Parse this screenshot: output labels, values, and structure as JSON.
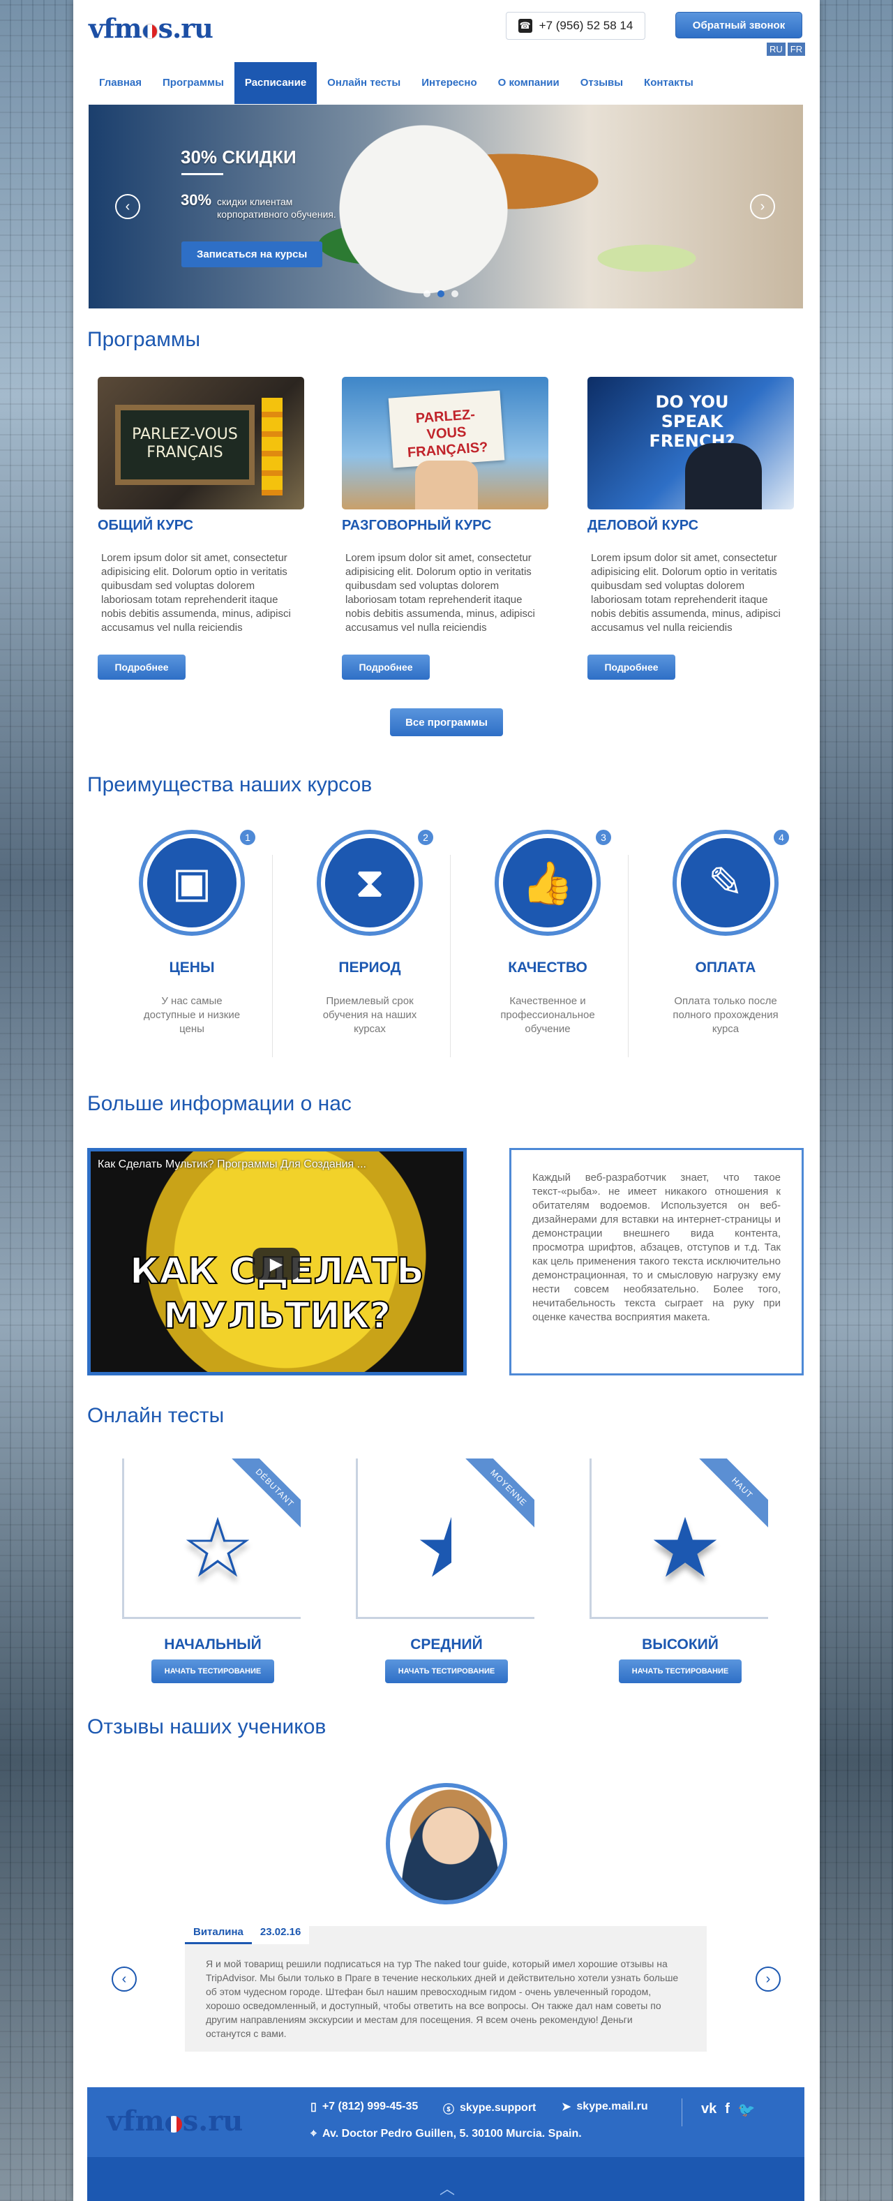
{
  "header": {
    "logo": "vfm s.ru",
    "logo_a": "vfm",
    "logo_b": "s.ru",
    "phone": "+7 (956) 52 58 14",
    "callback": "Обратный звонок",
    "langs": [
      "RU",
      "FR"
    ]
  },
  "nav": [
    "Главная",
    "Программы",
    "Расписание",
    "Онлайн тесты",
    "Интересно",
    "О компании",
    "Отзывы",
    "Контакты"
  ],
  "nav_active": "Расписание",
  "slider": {
    "title": "30% СКИДКИ",
    "big": "30%",
    "sub": "скидки клиентам корпоративного обучения.",
    "button": "Записаться на курсы"
  },
  "programs": {
    "heading": "Программы",
    "cards": [
      {
        "title": "ОБЩИЙ КУРС",
        "img_text": "PARLEZ-VOUS FRANÇAIS",
        "desc": "Lorem ipsum dolor sit amet, consectetur adipisicing elit. Dolorum optio in veritatis quibusdam sed voluptas dolorem laboriosam totam reprehenderit itaque nobis debitis assumenda, minus, adipisci accusamus vel nulla reiciendis",
        "button": "Подробнее"
      },
      {
        "title": "РАЗГОВОРНЫЙ КУРС",
        "img_text": "PARLEZ-VOUS FRANÇAIS?",
        "desc": "Lorem ipsum dolor sit amet, consectetur adipisicing elit. Dolorum optio in veritatis quibusdam sed voluptas dolorem laboriosam totam reprehenderit itaque nobis debitis assumenda, minus, adipisci accusamus vel nulla reiciendis",
        "button": "Подробнее"
      },
      {
        "title": "ДЕЛОВОЙ КУРС",
        "img_text": "DO YOU SPEAK FRENCH?",
        "desc": "Lorem ipsum dolor sit amet, consectetur adipisicing elit. Dolorum optio in veritatis quibusdam sed voluptas dolorem laboriosam totam reprehenderit itaque nobis debitis assumenda, minus, adipisci accusamus vel nulla reiciendis",
        "button": "Подробнее"
      }
    ],
    "all_button": "Все программы"
  },
  "advantages": {
    "heading": "Преимущества наших курсов",
    "items": [
      {
        "num": "1",
        "title": "ЦЕНЫ",
        "desc": "У нас самые доступные и низкие цены",
        "icon": "wallet-icon"
      },
      {
        "num": "2",
        "title": "ПЕРИОД",
        "desc": "Приемлевый срок обучения на наших курсах",
        "icon": "hourglass-icon"
      },
      {
        "num": "3",
        "title": "КАЧЕСТВО",
        "desc": "Качественное и профессиональное обучение",
        "icon": "thumbs-up-icon"
      },
      {
        "num": "4",
        "title": "ОПЛАТА",
        "desc": "Оплата только после полного прохождения курса",
        "icon": "document-pen-icon"
      }
    ]
  },
  "about": {
    "heading": "Больше информации о нас",
    "video_title": "Как Сделать Мультик? Программы Для Создания ...",
    "video_big": "КАК СДЕЛАТЬ МУЛЬТИК?",
    "text": "Каждый веб-разработчик знает, что такое текст-«рыба». не имеет никакого отношения к обитателям водоемов. Используется он веб-дизайнерами для вставки на интернет-страницы и демонстрации внешнего вида контента, просмотра шрифтов, абзацев, отступов и т.д. Так как цель применения такого текста исключительно демонстрационная, то и смысловую нагрузку ему нести совсем необязательно. Более того, нечитабельность текста сыграет на руку при оценке качества восприятия макета."
  },
  "tests": {
    "heading": "Онлайн тесты",
    "items": [
      {
        "ribbon": "DÉBUTANT",
        "title": "НАЧАЛЬНЫЙ",
        "button": "НАЧАТЬ ТЕСТИРОВАНИЕ",
        "fill": 0
      },
      {
        "ribbon": "MOYENNE",
        "title": "СРЕДНИЙ",
        "button": "НАЧАТЬ ТЕСТИРОВАНИЕ",
        "fill": 0.5
      },
      {
        "ribbon": "HAUT",
        "title": "ВЫСОКИЙ",
        "button": "НАЧАТЬ ТЕСТИРОВАНИЕ",
        "fill": 1
      }
    ]
  },
  "reviews": {
    "heading": "Отзывы наших учеников",
    "name": "Виталина",
    "date": "23.02.16",
    "text": "Я и мой товарищ решили подписаться на тур The naked tour guide, который имел хорошие отзывы на TripAdvisor. Мы были только в Праге в течение нескольких дней и действительно хотели узнать больше об этом чудесном городе. Штефан был нашим превосходным гидом - очень увлеченный городом, хорошо осведомленный, и доступный, чтобы ответить на все вопросы. Он также дал нам советы по другим направлениям экскурсии и местам для посещения. Я всем очень рекомендую! Деньги останутся с вами."
  },
  "footer": {
    "phone": "+7 (812) 999-45-35",
    "skype": "skype.support",
    "mail": "skype.mail.ru",
    "address": "Av. Doctor Pedro Guillen, 5. 30100 Murcia. Spain.",
    "social": [
      "vk",
      "f",
      "twitter"
    ]
  }
}
